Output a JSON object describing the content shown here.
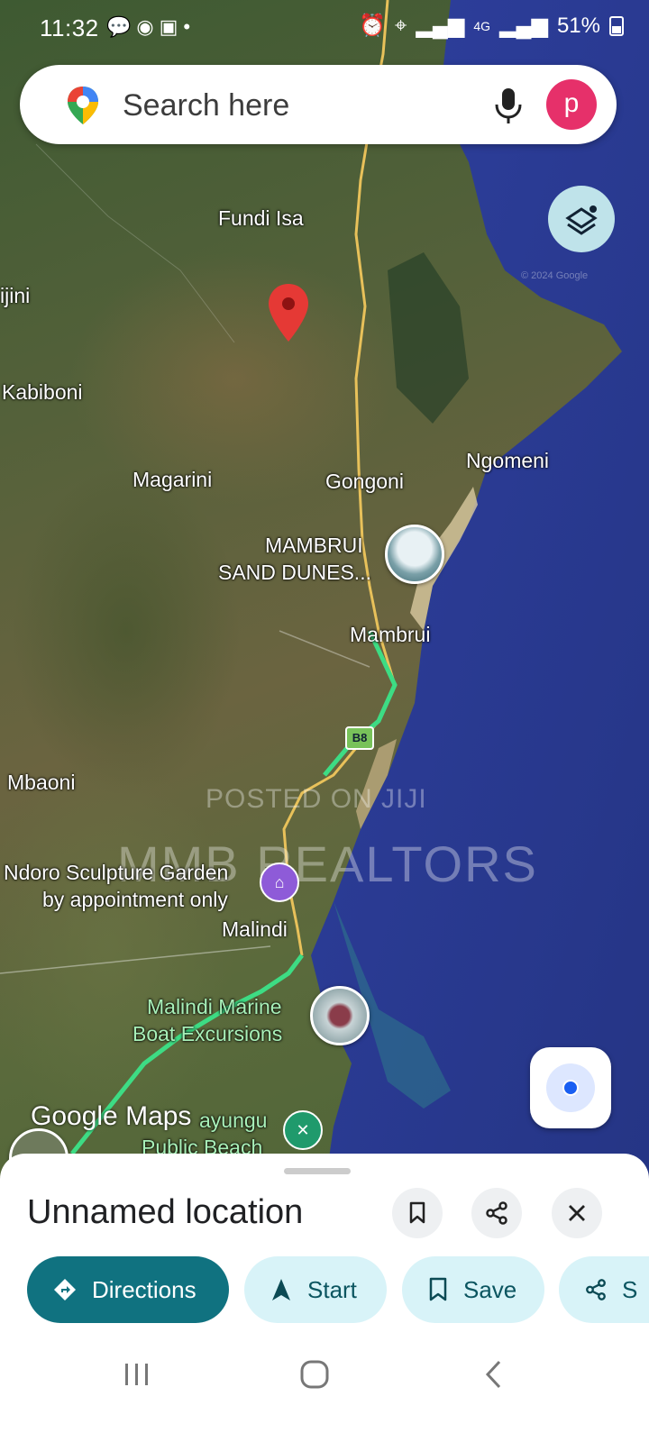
{
  "status_bar": {
    "time": "11:32",
    "network": "4G",
    "battery": "51%"
  },
  "search": {
    "placeholder": "Search here",
    "avatar_letter": "p"
  },
  "map": {
    "labels": [
      "Fundi Isa",
      "ijini",
      "Kabiboni",
      "Magarini",
      "Gongoni",
      "Ngomeni",
      "MAMBRUI",
      "SAND DUNES...",
      "Mambrui",
      "Mbaoni",
      "Ndoro Sculpture Garden",
      "by appointment only",
      "Malindi",
      "Malindi Marine",
      "Boat Excursions",
      "ayungu",
      "Public Beach"
    ],
    "road_shield": "B8",
    "watermark_line1": "POSTED ON JIJI",
    "watermark_line2": "MMB REALTORS",
    "logo": "Google Maps",
    "copyright": "© 2024 Google",
    "colors": {
      "ocean": "#2f3f9c",
      "route": "#3ddc84",
      "pin": "#e53935"
    }
  },
  "sheet": {
    "title": "Unnamed location",
    "actions": {
      "directions": "Directions",
      "start": "Start",
      "save": "Save",
      "share": "S"
    },
    "colors": {
      "primary": "#107280",
      "chip": "#d8f3f8"
    }
  }
}
